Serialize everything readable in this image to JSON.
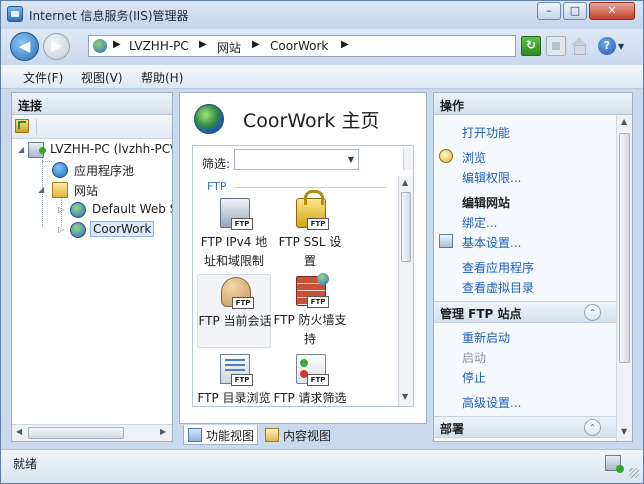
{
  "window": {
    "title": "Internet 信息服务(IIS)管理器",
    "controls": {
      "minimize": "–",
      "maximize": "□",
      "close": "✕"
    }
  },
  "navbar": {
    "back_glyph": "◀",
    "forward_glyph": "▶",
    "breadcrumb": [
      "LVZHH-PC",
      "网站",
      "CoorWork"
    ],
    "separator": "▶",
    "help_glyph": "?",
    "help_dropdown": "▼",
    "refresh_glyph": "↻"
  },
  "menu": [
    "文件(F)",
    "视图(V)",
    "帮助(H)"
  ],
  "connections": {
    "header": "连接",
    "tree": [
      {
        "label": "LVZHH-PC (lvzhh-PC\\",
        "icon": "server-icon",
        "expander": "◢"
      },
      {
        "label": "应用程序池",
        "icon": "app-pool-icon"
      },
      {
        "label": "网站",
        "icon": "sites-folder-icon",
        "expander": "◢"
      },
      {
        "label": "Default Web Site",
        "icon": "globe-icon",
        "expander": "▷"
      },
      {
        "label": "CoorWork",
        "icon": "globe-icon",
        "expander": "▷"
      }
    ]
  },
  "home": {
    "title": "CoorWork 主页",
    "filter_label": "筛选:",
    "filter_value": "",
    "group": "FTP",
    "features": [
      {
        "name": "FTP IPv4 地址和域限制",
        "icon": "ipv4-restriction-icon",
        "tag": "FTP"
      },
      {
        "name": "FTP SSL 设置",
        "icon": "ssl-lock-icon",
        "tag": "FTP"
      },
      {
        "name": "FTP 当前会话",
        "icon": "current-sessions-icon",
        "tag": "FTP"
      },
      {
        "name": "FTP 防火墙支持",
        "icon": "firewall-icon",
        "tag": "FTP"
      },
      {
        "name": "FTP 目录浏览",
        "icon": "directory-browsing-icon",
        "tag": "FTP"
      },
      {
        "name": "FTP 请求筛选",
        "icon": "request-filtering-icon",
        "tag": "FTP"
      }
    ],
    "view_tabs": [
      "功能视图",
      "内容视图"
    ]
  },
  "actions": {
    "header": "操作",
    "items": [
      "打开功能",
      "浏览",
      "编辑权限..."
    ],
    "edit_site": {
      "heading": "编辑网站",
      "items": [
        "绑定...",
        "基本设置...",
        "查看应用程序",
        "查看虚拟目录"
      ]
    },
    "manage_ftp": {
      "heading": "管理 FTP 站点",
      "items": [
        {
          "label": "重新启动",
          "enabled": true
        },
        {
          "label": "启动",
          "enabled": false
        },
        {
          "label": "停止",
          "enabled": true
        }
      ],
      "advanced": "高级设置..."
    },
    "deploy": {
      "heading": "部署"
    }
  },
  "status": {
    "text": "就绪"
  },
  "colors": {
    "link": "#1f5fb8",
    "group_label": "#3b73b9",
    "disabled": "#8c96a3"
  }
}
